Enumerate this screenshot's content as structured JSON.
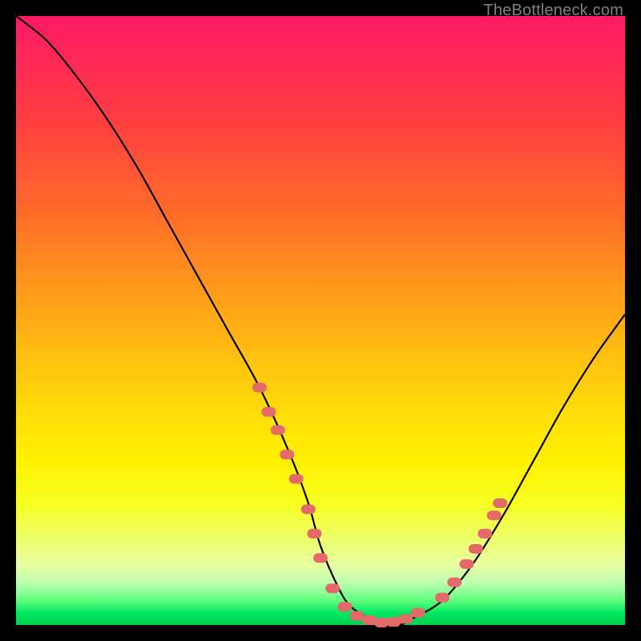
{
  "watermark": "TheBottleneck.com",
  "colors": {
    "background": "#000000",
    "curve": "#000000",
    "markers": "#e46a6a",
    "gradient_stops": [
      "#ff1a66",
      "#ff4040",
      "#ff9a1a",
      "#ffe008",
      "#f8ff20",
      "#60ff80",
      "#00d050"
    ]
  },
  "chart_data": {
    "type": "line",
    "title": "",
    "xlabel": "",
    "ylabel": "",
    "xlim": [
      0,
      100
    ],
    "ylim": [
      0,
      100
    ],
    "grid": false,
    "legend": false,
    "series": [
      {
        "name": "bottleneck-curve",
        "x": [
          0,
          5,
          10,
          15,
          20,
          25,
          30,
          35,
          40,
          45,
          48,
          50,
          53,
          55,
          58,
          60,
          63,
          65,
          70,
          75,
          80,
          85,
          90,
          95,
          100
        ],
        "y": [
          100,
          96,
          90,
          83,
          75,
          66,
          57,
          48,
          39,
          28,
          20,
          13,
          6,
          3,
          1,
          0,
          0,
          1,
          4,
          10,
          18,
          27,
          36,
          44,
          51
        ]
      }
    ],
    "markers": {
      "name": "highlighted-band",
      "color": "#e46a6a",
      "points": [
        {
          "x": 40,
          "y": 39
        },
        {
          "x": 41.5,
          "y": 35
        },
        {
          "x": 43,
          "y": 32
        },
        {
          "x": 44.5,
          "y": 28
        },
        {
          "x": 46,
          "y": 24
        },
        {
          "x": 48,
          "y": 19
        },
        {
          "x": 49,
          "y": 15
        },
        {
          "x": 50,
          "y": 11
        },
        {
          "x": 52,
          "y": 6
        },
        {
          "x": 54,
          "y": 3
        },
        {
          "x": 56,
          "y": 1.5
        },
        {
          "x": 58,
          "y": 0.8
        },
        {
          "x": 60,
          "y": 0.4
        },
        {
          "x": 62,
          "y": 0.5
        },
        {
          "x": 64,
          "y": 1
        },
        {
          "x": 66,
          "y": 2
        },
        {
          "x": 70,
          "y": 4.5
        },
        {
          "x": 72,
          "y": 7
        },
        {
          "x": 74,
          "y": 10
        },
        {
          "x": 75.5,
          "y": 12.5
        },
        {
          "x": 77,
          "y": 15
        },
        {
          "x": 78.5,
          "y": 18
        },
        {
          "x": 79.5,
          "y": 20
        }
      ]
    }
  }
}
